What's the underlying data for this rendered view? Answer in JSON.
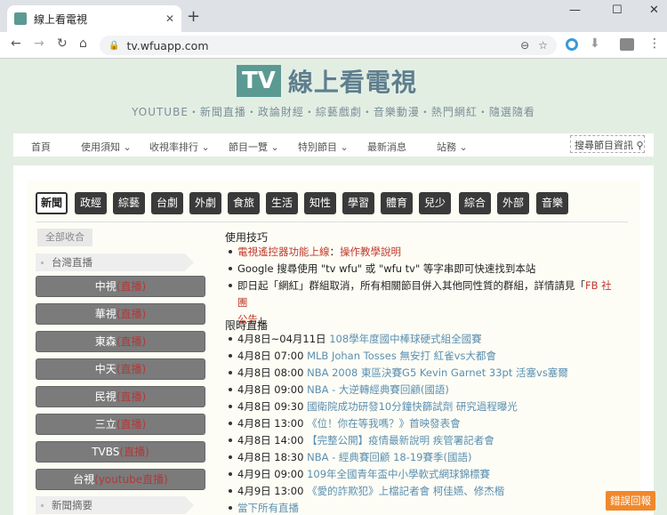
{
  "browser": {
    "tab_title": "線上看電視",
    "url": "tv.wfuapp.com"
  },
  "site": {
    "logo_tv": "TV",
    "logo_name": "線上看電視",
    "tagline": "YOUTUBE・新聞直播・政論財經・綜藝戲劇・音樂動漫・熱門網紅・隨選隨看",
    "nav": [
      "首頁",
      "使用須知",
      "收視率排行",
      "節目一覽",
      "特別節目",
      "最新消息",
      "站務"
    ],
    "search_label": "搜尋節目資訊"
  },
  "categories": [
    "新聞",
    "政經",
    "綜藝",
    "台劇",
    "外劇",
    "食旅",
    "生活",
    "知性",
    "學習",
    "體育",
    "兒少",
    "綜合",
    "外部",
    "音樂"
  ],
  "sidebar": {
    "collapse_all": "全部收合",
    "group1": "台灣直播",
    "channels": [
      {
        "name": "中視",
        "live": "(直播)"
      },
      {
        "name": "華視",
        "live": "(直播)"
      },
      {
        "name": "東森",
        "live": "(直播)"
      },
      {
        "name": "中天",
        "live": "(直播)"
      },
      {
        "name": "民視",
        "live": "(直播)"
      },
      {
        "name": "三立",
        "live": "(直播)"
      },
      {
        "name": "TVBS",
        "live": "(直播)"
      },
      {
        "name": "台視",
        "live": "(youtube直播)"
      }
    ],
    "group2": "新聞摘要"
  },
  "tips": {
    "title": "使用技巧",
    "item1_link": "電視遙控器功能上線",
    "item1_sep": "：",
    "item1_link2": "操作教學說明",
    "item2": "Google 搜尋使用 \"tv wfu\" 或 \"wfu tv\" 等字串即可快速找到本站",
    "item3_a": "即日起「網紅」群組取消，所有相關節目併入其他同性質的群組，詳情請見「",
    "item3_link": "FB 社團",
    "item3_b": "公告",
    "item3_c": "」"
  },
  "limited": {
    "title": "限時直播",
    "items": [
      {
        "time": "4月8日~04月11日",
        "title": "108學年度國中棒球硬式組全國賽"
      },
      {
        "time": "4月8日 07:00",
        "title": "MLB Johan Tosses 無安打 紅雀vs大都會"
      },
      {
        "time": "4月8日 08:00",
        "title": "NBA 2008 東區決賽G5 Kevin Garnet 33pt 活塞vs塞爾"
      },
      {
        "time": "4月8日 09:00",
        "title": "NBA - 大逆轉經典賽回顧(國語)"
      },
      {
        "time": "4月8日 09:30",
        "title": "國衛院成功研發10分鐘快篩試劑 研究過程曝光"
      },
      {
        "time": "4月8日 13:00",
        "title": "《位！你在等我嗎？》首映發表會"
      },
      {
        "time": "4月8日 14:00",
        "title": "【完整公開】疫情最新說明 疾管署記者會"
      },
      {
        "time": "4月8日 18:30",
        "title": "NBA - 經典賽回顧 18-19賽季(國語)"
      },
      {
        "time": "4月9日 09:00",
        "title": "109年全國青年盃中小學軟式網球錦標賽"
      },
      {
        "time": "4月9日 13:00",
        "title": "《愛的詐欺犯》上檔記者會 柯佳嬿、修杰楷"
      }
    ],
    "more": "當下所有直播"
  },
  "report_button": "錯誤回報"
}
